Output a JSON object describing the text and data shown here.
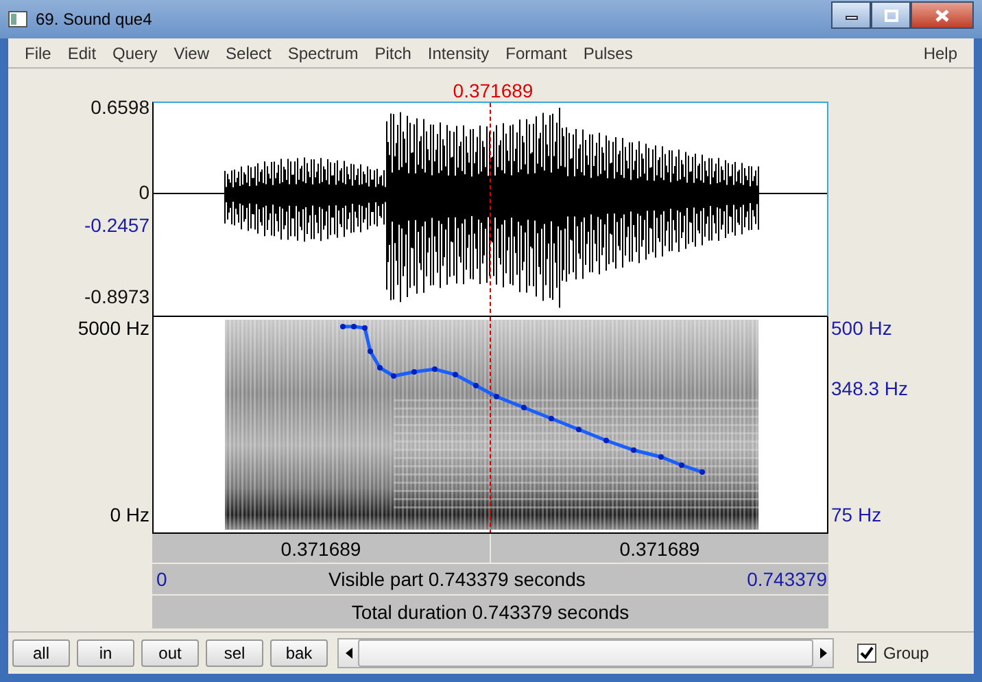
{
  "window": {
    "title": "69. Sound que4"
  },
  "menu": [
    {
      "label": "File"
    },
    {
      "label": "Edit"
    },
    {
      "label": "Query"
    },
    {
      "label": "View"
    },
    {
      "label": "Select"
    },
    {
      "label": "Spectrum"
    },
    {
      "label": "Pitch"
    },
    {
      "label": "Intensity"
    },
    {
      "label": "Formant"
    },
    {
      "label": "Pulses"
    }
  ],
  "help_menu": {
    "label": "Help"
  },
  "cursor": {
    "time": "0.371689"
  },
  "waveform": {
    "axis_left": [
      {
        "label": "0.6598",
        "kind": "plain"
      },
      {
        "label": "0",
        "kind": "plain"
      },
      {
        "label": "-0.2457",
        "kind": "marked"
      },
      {
        "label": "-0.8973",
        "kind": "plain"
      }
    ]
  },
  "spectrogram": {
    "axis_left": [
      {
        "label": "5000 Hz"
      },
      {
        "label": "0 Hz"
      }
    ],
    "axis_right": [
      {
        "label": "500 Hz"
      },
      {
        "label": "348.3 Hz"
      },
      {
        "label": "75 Hz"
      }
    ]
  },
  "selection_bar": [
    "0.371689",
    "0.371689"
  ],
  "visible_bar": {
    "start": "0",
    "label": "Visible part 0.743379 seconds",
    "end": "0.743379"
  },
  "total_bar": {
    "label": "Total duration 0.743379 seconds"
  },
  "buttons": [
    "all",
    "in",
    "out",
    "sel",
    "bak"
  ],
  "group": {
    "label": "Group",
    "checked": true
  }
}
